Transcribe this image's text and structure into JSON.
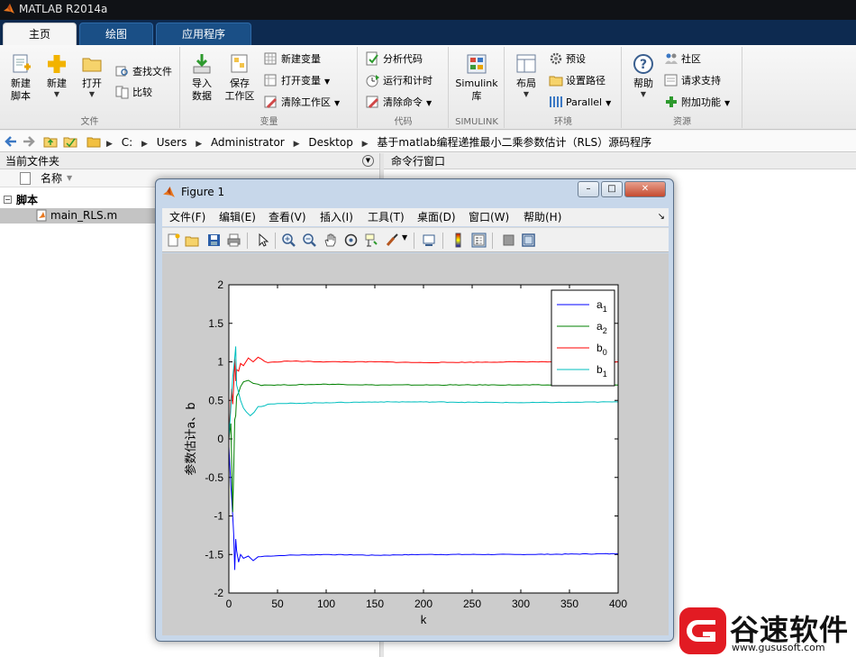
{
  "app": {
    "title": "MATLAB R2014a"
  },
  "colors": {
    "accent_orange": "#e8771f",
    "tab_blue": "#1a4f86",
    "tabbar_bg": "#0d2a50",
    "watermark_red": "#e21b23"
  },
  "ribbon": {
    "tabs": [
      "主页",
      "绘图",
      "应用程序"
    ],
    "groups": {
      "file": {
        "label": "文件",
        "new_script": "新建\n脚本",
        "new": "新建",
        "open": "打开",
        "find_files": "查找文件",
        "compare": "比较"
      },
      "variable": {
        "label": "变量",
        "import_data": "导入\n数据",
        "save_workspace": "保存\n工作区",
        "new_variable": "新建变量",
        "open_variable": "打开变量",
        "clear_workspace": "清除工作区"
      },
      "code": {
        "label": "代码",
        "analyze_code": "分析代码",
        "run_and_time": "运行和计时",
        "clear_commands": "清除命令"
      },
      "simulink": {
        "label": "SIMULINK",
        "library": "Simulink\n库"
      },
      "environment": {
        "label": "环境",
        "layout": "布局",
        "preferences": "预设",
        "set_path": "设置路径",
        "parallel": "Parallel"
      },
      "resources": {
        "label": "资源",
        "help": "帮助",
        "community": "社区",
        "request_support": "请求支持",
        "add_ons": "附加功能"
      }
    }
  },
  "address": {
    "path": [
      "C:",
      "Users",
      "Administrator",
      "Desktop",
      "基于matlab编程递推最小二乘参数估计（RLS）源码程序"
    ]
  },
  "current_folder": {
    "title": "当前文件夹",
    "column_name": "名称",
    "section": "脚本",
    "section_toggle": "−",
    "files": [
      "main_RLS.m"
    ]
  },
  "command_window": {
    "title": "命令行窗口"
  },
  "figure": {
    "title": "Figure 1",
    "window_buttons": {
      "minimize": "–",
      "maximize": "□",
      "close": "✕"
    },
    "menu": [
      "文件(F)",
      "编辑(E)",
      "查看(V)",
      "插入(I)",
      "工具(T)",
      "桌面(D)",
      "窗口(W)",
      "帮助(H)"
    ],
    "dock_glyph": "↘",
    "toolbar_icons": [
      "new-figure-icon",
      "open-file-icon",
      "save-icon",
      "print-icon",
      "pointer-icon",
      "zoom-in-icon",
      "zoom-out-icon",
      "pan-hand-icon",
      "rotate-3d-icon",
      "data-cursor-icon",
      "brush-icon",
      "link-plot-icon",
      "colorbar-icon",
      "legend-icon",
      "hide-plot-tools-icon",
      "show-plot-tools-icon"
    ]
  },
  "watermark": {
    "text": "谷速软件",
    "url": "www.gususoft.com"
  },
  "chart_data": {
    "type": "line",
    "title": "",
    "xlabel": "k",
    "ylabel": "参数估计a、b",
    "xlim": [
      0,
      400
    ],
    "ylim": [
      -2,
      2
    ],
    "xticks": [
      0,
      50,
      100,
      150,
      200,
      250,
      300,
      350,
      400
    ],
    "yticks": [
      -2,
      -1.5,
      -1,
      -0.5,
      0,
      0.5,
      1,
      1.5,
      2
    ],
    "grid": false,
    "legend_position": "top-right",
    "series": [
      {
        "name": "a1",
        "label_base": "a",
        "label_sub": "1",
        "color": "#0000ff",
        "final": -1.5,
        "points": [
          [
            0,
            -0.1
          ],
          [
            2,
            -0.6
          ],
          [
            4,
            -1.0
          ],
          [
            5,
            -1.25
          ],
          [
            6,
            -1.7
          ],
          [
            7,
            -1.3
          ],
          [
            8,
            -1.45
          ],
          [
            10,
            -1.6
          ],
          [
            12,
            -1.5
          ],
          [
            15,
            -1.55
          ],
          [
            20,
            -1.52
          ],
          [
            25,
            -1.58
          ],
          [
            30,
            -1.53
          ],
          [
            40,
            -1.52
          ],
          [
            60,
            -1.51
          ],
          [
            100,
            -1.5
          ],
          [
            150,
            -1.51
          ],
          [
            200,
            -1.5
          ],
          [
            300,
            -1.5
          ],
          [
            400,
            -1.49
          ]
        ]
      },
      {
        "name": "a2",
        "label_base": "a",
        "label_sub": "2",
        "color": "#008000",
        "final": 0.7,
        "points": [
          [
            0,
            0.0
          ],
          [
            2,
            0.2
          ],
          [
            4,
            -0.95
          ],
          [
            5,
            -0.4
          ],
          [
            6,
            0.25
          ],
          [
            7,
            0.3
          ],
          [
            8,
            0.55
          ],
          [
            10,
            0.6
          ],
          [
            12,
            0.68
          ],
          [
            15,
            0.74
          ],
          [
            20,
            0.76
          ],
          [
            25,
            0.72
          ],
          [
            30,
            0.71
          ],
          [
            40,
            0.7
          ],
          [
            60,
            0.7
          ],
          [
            100,
            0.71
          ],
          [
            150,
            0.7
          ],
          [
            200,
            0.7
          ],
          [
            300,
            0.7
          ],
          [
            400,
            0.7
          ]
        ]
      },
      {
        "name": "b0",
        "label_base": "b",
        "label_sub": "0",
        "color": "#ff0000",
        "final": 1.0,
        "points": [
          [
            0,
            0.0
          ],
          [
            2,
            0.5
          ],
          [
            3,
            0.65
          ],
          [
            4,
            0.45
          ],
          [
            5,
            0.7
          ],
          [
            6,
            1.05
          ],
          [
            7,
            0.75
          ],
          [
            8,
            0.9
          ],
          [
            10,
            0.88
          ],
          [
            12,
            0.98
          ],
          [
            15,
            0.95
          ],
          [
            20,
            1.05
          ],
          [
            25,
            1.0
          ],
          [
            30,
            1.06
          ],
          [
            40,
            0.99
          ],
          [
            60,
            1.01
          ],
          [
            100,
            1.0
          ],
          [
            150,
            1.0
          ],
          [
            200,
            0.99
          ],
          [
            300,
            1.0
          ],
          [
            400,
            1.0
          ]
        ]
      },
      {
        "name": "b1",
        "label_base": "b",
        "label_sub": "1",
        "color": "#00bfbf",
        "final": 0.48,
        "points": [
          [
            0,
            0.0
          ],
          [
            2,
            0.4
          ],
          [
            4,
            0.8
          ],
          [
            6,
            1.05
          ],
          [
            7,
            1.2
          ],
          [
            8,
            0.7
          ],
          [
            10,
            0.6
          ],
          [
            12,
            0.5
          ],
          [
            15,
            0.4
          ],
          [
            18,
            0.35
          ],
          [
            22,
            0.3
          ],
          [
            30,
            0.42
          ],
          [
            40,
            0.45
          ],
          [
            60,
            0.46
          ],
          [
            100,
            0.47
          ],
          [
            150,
            0.48
          ],
          [
            200,
            0.48
          ],
          [
            300,
            0.47
          ],
          [
            400,
            0.48
          ]
        ]
      }
    ]
  }
}
